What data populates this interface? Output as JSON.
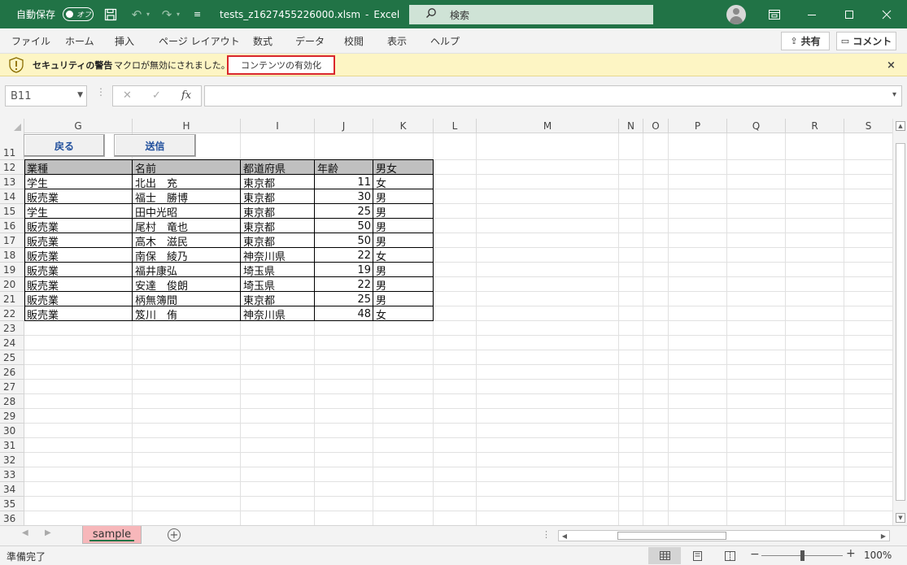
{
  "titlebar": {
    "autosave_label": "自動保存",
    "autosave_state": "オフ",
    "filename": "tests_z1627455226000.xlsm",
    "separator": "-",
    "app_name": "Excel",
    "search_placeholder": "検索"
  },
  "ribbon": {
    "tabs": [
      "ファイル",
      "ホーム",
      "挿入",
      "ページ レイアウト",
      "数式",
      "データ",
      "校閲",
      "表示",
      "ヘルプ"
    ],
    "share_label": "共有",
    "comment_label": "コメント"
  },
  "security": {
    "title": "セキュリティの警告",
    "message": "マクロが無効にされました。",
    "enable_button": "コンテンツの有効化",
    "close": "×"
  },
  "formula_bar": {
    "name_box": "B11",
    "cancel": "✕",
    "enter": "✓",
    "fx": "fx",
    "formula": ""
  },
  "columns": [
    "G",
    "H",
    "I",
    "J",
    "K",
    "L",
    "M",
    "N",
    "O",
    "P",
    "Q",
    "R",
    "S"
  ],
  "rows": [
    "11",
    "12",
    "13",
    "14",
    "15",
    "16",
    "17",
    "18",
    "19",
    "20",
    "21",
    "22",
    "23",
    "24",
    "25",
    "26",
    "27",
    "28",
    "29",
    "30",
    "31",
    "32",
    "33",
    "34",
    "35",
    "36"
  ],
  "sheet_buttons": {
    "back": "戻る",
    "send": "送信"
  },
  "table": {
    "headers": [
      "業種",
      "名前",
      "都道府県",
      "年齢",
      "男女"
    ],
    "rows": [
      [
        "学生",
        "北出　充",
        "東京都",
        "11",
        "女"
      ],
      [
        "販売業",
        "福士　勝博",
        "東京都",
        "30",
        "男"
      ],
      [
        "学生",
        "田中光昭",
        "東京都",
        "25",
        "男"
      ],
      [
        "販売業",
        "尾村　竜也",
        "東京都",
        "50",
        "男"
      ],
      [
        "販売業",
        "高木　滋民",
        "東京都",
        "50",
        "男"
      ],
      [
        "販売業",
        "南保　綾乃",
        "神奈川県",
        "22",
        "女"
      ],
      [
        "販売業",
        "福井康弘",
        "埼玉県",
        "19",
        "男"
      ],
      [
        "販売業",
        "安達　俊朗",
        "埼玉県",
        "22",
        "男"
      ],
      [
        "販売業",
        "柄無簿間",
        "東京都",
        "25",
        "男"
      ],
      [
        "販売業",
        "笈川　侑",
        "神奈川県",
        "48",
        "女"
      ]
    ]
  },
  "sheets": {
    "active": "sample",
    "add": "+"
  },
  "status": {
    "text": "準備完了",
    "zoom_minus": "−",
    "zoom_plus": "+",
    "zoom_level": "100%"
  },
  "colors": {
    "excel_green": "#217346",
    "security_bar": "#fdf5c4",
    "sheet_tab": "#f7b7ba",
    "header_fill": "#c0c0c0",
    "button_text": "#1f4e9c",
    "highlight_border": "#d9262b"
  }
}
